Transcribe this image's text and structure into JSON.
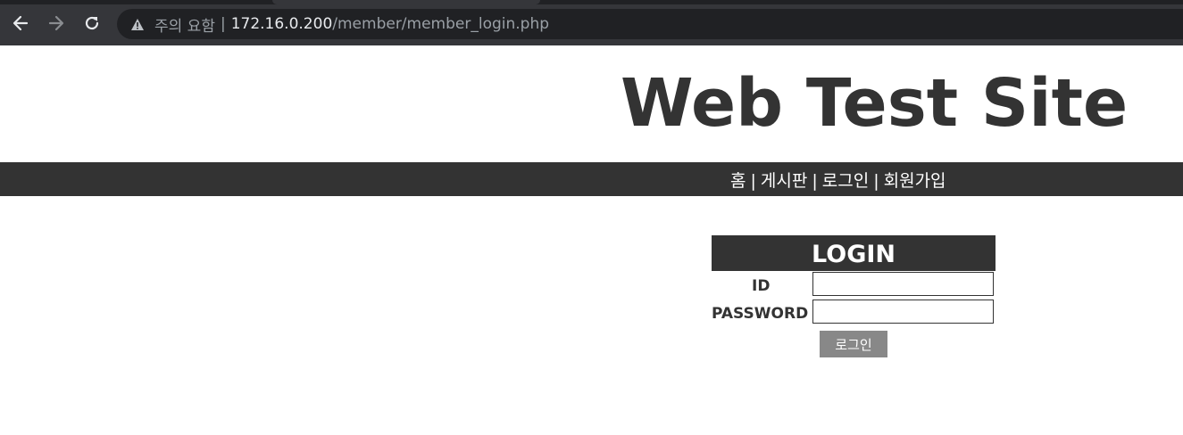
{
  "browser": {
    "security_label": "주의 요함",
    "separator": "|",
    "url_host": "172.16.0.200",
    "url_path": "/member/member_login.php",
    "icons": {
      "back": "arrow-left-icon",
      "forward": "arrow-right-icon",
      "reload": "reload-icon",
      "warning": "warning-triangle-icon"
    }
  },
  "header": {
    "site_title": "Web Test Site"
  },
  "nav": {
    "items": [
      {
        "label": "홈"
      },
      {
        "label": "게시판"
      },
      {
        "label": "로그인"
      },
      {
        "label": "회원가입"
      }
    ],
    "separator": "|"
  },
  "login": {
    "title": "LOGIN",
    "id_label": "ID",
    "id_value": "",
    "password_label": "PASSWORD",
    "password_value": "",
    "submit_label": "로그인"
  },
  "colors": {
    "dark": "#333333",
    "button": "#888888",
    "chrome_bg": "#35363a",
    "omnibox_bg": "#202124"
  }
}
